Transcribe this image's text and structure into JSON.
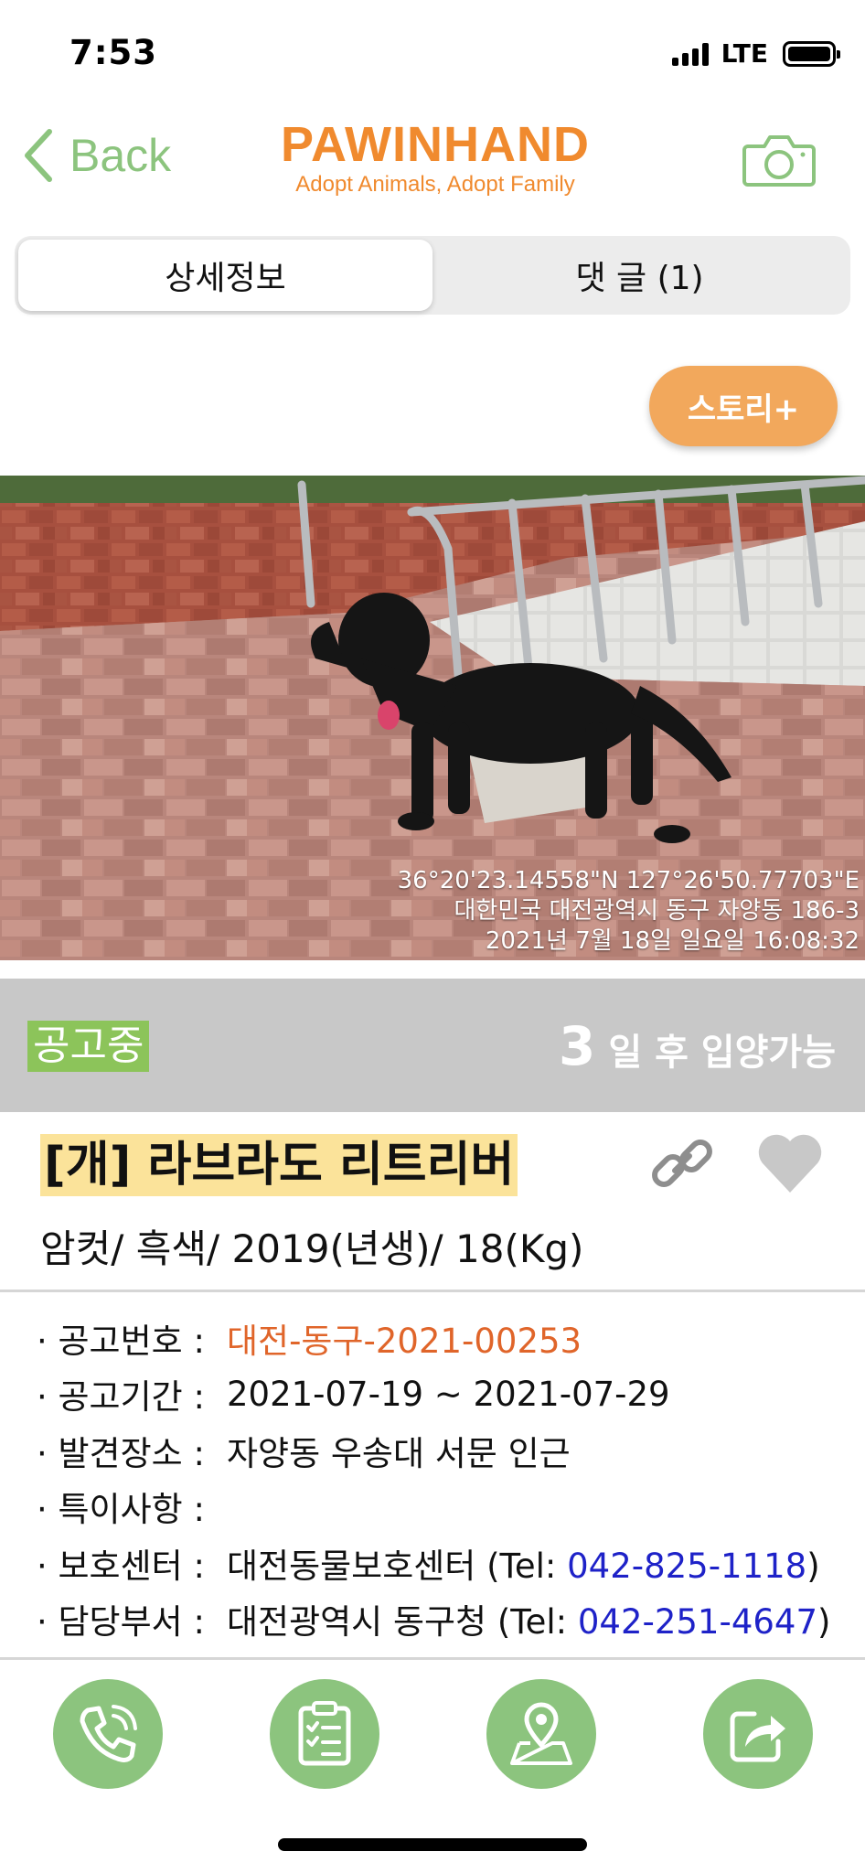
{
  "status_bar": {
    "time": "7:53",
    "network": "LTE"
  },
  "nav": {
    "back_label": "Back",
    "logo_title": "PAWINHAND",
    "logo_subtitle": "Adopt Animals, Adopt Family"
  },
  "tabs": [
    {
      "label": "상세정보",
      "active": true
    },
    {
      "label": "댓 글 (1)",
      "active": false
    }
  ],
  "story_button": "스토리+",
  "photo": {
    "geo_lines": [
      "36°20'23.14558\"N 127°26'50.77703\"E",
      "대한민국 대전광역시 동구 자양동 186-3",
      "2021년 7월 18일 일요일 16:08:32"
    ]
  },
  "notice": {
    "status": "공고중",
    "days": "3",
    "days_text": "일 후 입양가능"
  },
  "animal": {
    "title": "[개] 라브라도 리트리버",
    "subtitle": "암컷/ 흑색/ 2019(년생)/ 18(Kg)"
  },
  "details": {
    "notice_no_label": "· 공고번호 :",
    "notice_no": "대전-동구-2021-00253",
    "period_label": "· 공고기간 :",
    "period": "2021-07-19 ~ 2021-07-29",
    "location_label": "· 발견장소 :",
    "location": "자양동 우송대 서문 인근",
    "notes_label": "· 특이사항 :",
    "notes": "",
    "center_label": "· 보호센터 :",
    "center_name": "대전동물보호센터 (Tel: ",
    "center_tel": "042-825-1118",
    "center_close": ")",
    "dept_label": "· 담당부서 :",
    "dept_name": "대전광역시 동구청 (Tel: ",
    "dept_tel": "042-251-4647",
    "dept_close": ")"
  },
  "colors": {
    "accent_green": "#8cc47e",
    "brand_orange": "#f08a2e",
    "story_orange": "#f2a85c",
    "notice_green": "#8cc45a",
    "title_highlight": "#fbe39a",
    "tel_blue": "#1e22c8"
  },
  "icons": {
    "back": "chevron-left-icon",
    "camera": "camera-icon",
    "link": "link-icon",
    "favorite": "heart-icon",
    "call": "phone-icon",
    "notice": "clipboard-icon",
    "map": "map-pin-icon",
    "share": "share-icon"
  }
}
